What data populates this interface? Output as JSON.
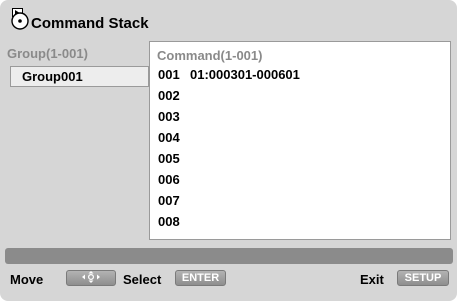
{
  "title": {
    "text": "Command Stack",
    "icon": "command-stack-disc-icon"
  },
  "group_panel": {
    "header": "Group(1-001)",
    "items": [
      {
        "label": "Group001",
        "selected": true
      }
    ]
  },
  "command_panel": {
    "header": "Command(1-001)",
    "rows": [
      {
        "num": "001",
        "value": "01:000301-000601"
      },
      {
        "num": "002",
        "value": ""
      },
      {
        "num": "003",
        "value": ""
      },
      {
        "num": "004",
        "value": ""
      },
      {
        "num": "005",
        "value": ""
      },
      {
        "num": "006",
        "value": ""
      },
      {
        "num": "007",
        "value": ""
      },
      {
        "num": "008",
        "value": ""
      }
    ]
  },
  "footer": {
    "move_label": "Move",
    "move_key_icon": "four-way-arrows-icon",
    "select_label": "Select",
    "select_key": "ENTER",
    "exit_label": "Exit",
    "exit_key": "SETUP"
  },
  "colors": {
    "screen_bg": "#d6d6d6",
    "panel_bg": "#ffffff",
    "header_text": "#8a8a8a",
    "bar": "#8b8b8b",
    "key_button": "#9f9f9f"
  }
}
